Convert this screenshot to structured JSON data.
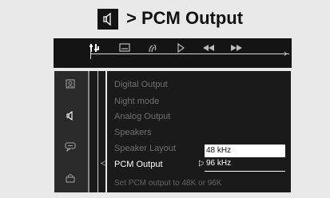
{
  "header": {
    "icon": "speaker-icon",
    "title": "> PCM Output"
  },
  "toolbar": {
    "icons": [
      "settings-icon",
      "subtitle-icon",
      "audio-icon",
      "play-icon",
      "rewind-icon",
      "fast-forward-icon"
    ]
  },
  "sidebar": {
    "icons": [
      "picture-icon",
      "speaker-icon",
      "chat-icon",
      "lock-icon"
    ]
  },
  "menu": {
    "items": [
      "Digital Output",
      "Night mode",
      "Analog Output",
      "Speakers",
      "Speaker Layout",
      "PCM Output"
    ],
    "active": "PCM Output"
  },
  "submenu": {
    "options": [
      "48 kHz",
      "96 kHz"
    ],
    "selected": "96 kHz"
  },
  "status": "Set PCM output to 48K or 96K"
}
